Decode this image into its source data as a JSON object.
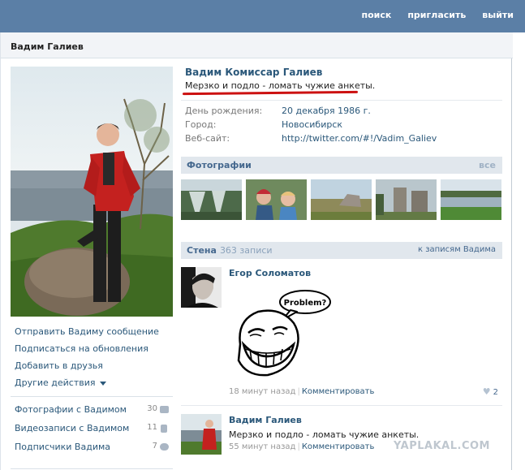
{
  "topnav": {
    "search": "поиск",
    "invite": "пригласить",
    "logout": "выйти"
  },
  "page": {
    "title": "Вадим Галиев"
  },
  "profile": {
    "full_name": "Вадим Комиссар Галиев",
    "status": "Мерзко и подло - ломать чужие анкеты.",
    "info": [
      {
        "key": "День рождения:",
        "value": "20 декабря 1986 г."
      },
      {
        "key": "Город:",
        "value": "Новосибирск"
      },
      {
        "key": "Веб-сайт:",
        "value": "http://twitter.com/#!/Vadim_Galiev"
      }
    ]
  },
  "actions": {
    "message": "Отправить Вадиму сообщение",
    "subscribe": "Подписаться на обновления",
    "add_friend": "Добавить в друзья",
    "other": "Другие действия"
  },
  "links": [
    {
      "label": "Фотографии с Вадимом",
      "count": "30",
      "icon": "camera-icon"
    },
    {
      "label": "Видеозаписи с Вадимом",
      "count": "11",
      "icon": "film-icon"
    },
    {
      "label": "Подписчики Вадима",
      "count": "7",
      "icon": "people-icon"
    }
  ],
  "photos_section": {
    "title": "Фотографии",
    "all": "все"
  },
  "wall": {
    "title": "Стена",
    "count": "363 записи",
    "link": "к записям Вадима"
  },
  "posts": [
    {
      "author": "Егор Соломатов",
      "bubble": "Problem?",
      "time": "18 минут назад",
      "comment": "Комментировать",
      "likes": "2"
    },
    {
      "author": "Вадим Галиев",
      "text": "Мерзко и подло - ломать чужие анкеты.",
      "time": "55 минут назад",
      "comment": "Комментировать"
    }
  ],
  "watermark": "YAPLAKAL.COM",
  "colors": {
    "topbar": "#5b7fa6",
    "link": "#2b587a",
    "section": "#e1e7ed",
    "underline": "#cc1111"
  }
}
